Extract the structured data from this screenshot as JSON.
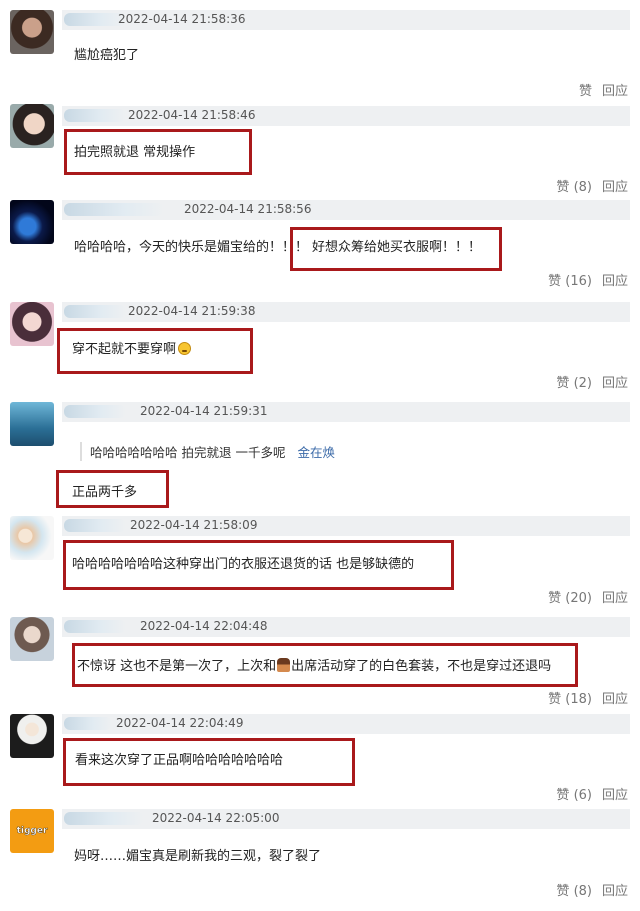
{
  "colors": {
    "highlight": "#a9191b",
    "meta_bar": "#eef0f2",
    "link": "#3b6aa8"
  },
  "actions": {
    "like": "赞",
    "reply": "回应"
  },
  "comments": [
    {
      "time": "2022-04-14 21:58:36",
      "text": "尴尬癌犯了",
      "likes": ""
    },
    {
      "time": "2022-04-14 21:58:46",
      "text": "拍完照就退 常规操作",
      "likes": "(8)"
    },
    {
      "time": "2022-04-14 21:58:56",
      "text_a": "哈哈哈哈，今天的快乐是媚宝给的！！！",
      "text_b": "好想众筹给她买衣服啊！！！",
      "likes": "(16)"
    },
    {
      "time": "2022-04-14 21:59:38",
      "text": "穿不起就不要穿啊",
      "emoji": "smile-emoji",
      "likes": "(2)"
    },
    {
      "time": "2022-04-14 21:59:31",
      "quote": "哈哈哈哈哈哈哈 拍完就退 一千多呢",
      "quote_user": "金在焕",
      "text": "正品两千多"
    },
    {
      "time": "2022-04-14 21:58:09",
      "text": "哈哈哈哈哈哈哈这种穿出门的衣服还退货的话 也是够缺德的",
      "likes": "(20)"
    },
    {
      "time": "2022-04-14 22:04:48",
      "text_a": "不惊讶 这也不是第一次了，上次和",
      "text_b": "出席活动穿了的白色套装，不也是穿过还退吗",
      "likes": "(18)"
    },
    {
      "time": "2022-04-14 22:04:49",
      "text": "看来这次穿了正品啊哈哈哈哈哈哈哈",
      "likes": "(6)"
    },
    {
      "time": "2022-04-14 22:05:00",
      "text": "妈呀……媚宝真是刷新我的三观，裂了裂了",
      "likes": "(8)",
      "avatar_text": "tigger"
    }
  ]
}
